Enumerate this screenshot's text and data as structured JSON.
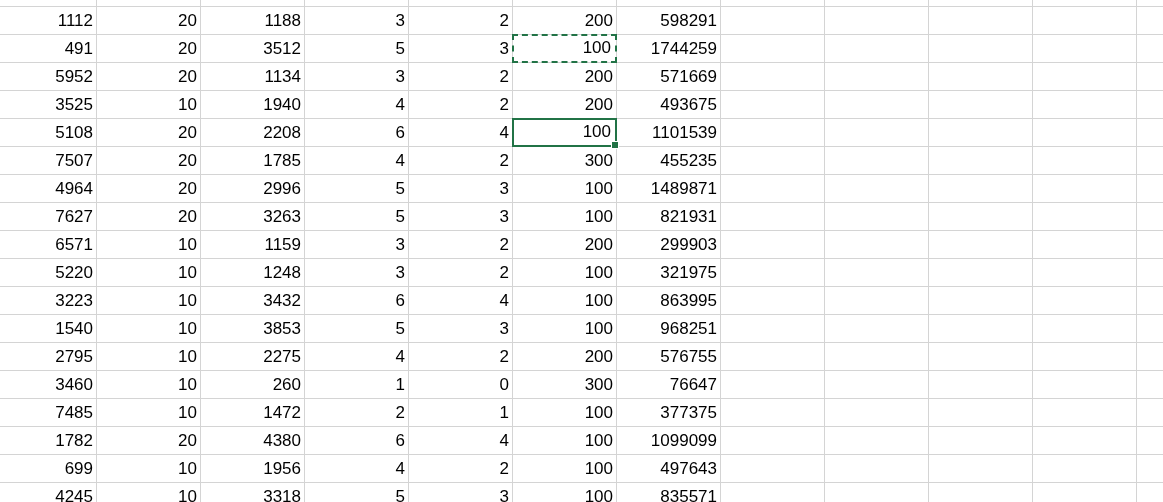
{
  "sheet": {
    "rows": [
      {
        "cells": [
          {
            "text": "1112",
            "selected": false,
            "copied": false
          },
          {
            "text": "20",
            "selected": false,
            "copied": false
          },
          {
            "text": "1188",
            "selected": false,
            "copied": false
          },
          {
            "text": "3",
            "selected": false,
            "copied": false
          },
          {
            "text": "2",
            "selected": false,
            "copied": false
          },
          {
            "text": "200",
            "selected": false,
            "copied": false
          },
          {
            "text": "598291",
            "selected": false,
            "copied": false
          }
        ]
      },
      {
        "cells": [
          {
            "text": "491",
            "selected": false,
            "copied": false
          },
          {
            "text": "20",
            "selected": false,
            "copied": false
          },
          {
            "text": "3512",
            "selected": false,
            "copied": false
          },
          {
            "text": "5",
            "selected": false,
            "copied": false
          },
          {
            "text": "3",
            "selected": false,
            "copied": false
          },
          {
            "text": "100",
            "selected": false,
            "copied": true
          },
          {
            "text": "1744259",
            "selected": false,
            "copied": false
          }
        ]
      },
      {
        "cells": [
          {
            "text": "5952",
            "selected": false,
            "copied": false
          },
          {
            "text": "20",
            "selected": false,
            "copied": false
          },
          {
            "text": "1134",
            "selected": false,
            "copied": false
          },
          {
            "text": "3",
            "selected": false,
            "copied": false
          },
          {
            "text": "2",
            "selected": false,
            "copied": false
          },
          {
            "text": "200",
            "selected": false,
            "copied": false
          },
          {
            "text": "571669",
            "selected": false,
            "copied": false
          }
        ]
      },
      {
        "cells": [
          {
            "text": "3525",
            "selected": false,
            "copied": false
          },
          {
            "text": "10",
            "selected": false,
            "copied": false
          },
          {
            "text": "1940",
            "selected": false,
            "copied": false
          },
          {
            "text": "4",
            "selected": false,
            "copied": false
          },
          {
            "text": "2",
            "selected": false,
            "copied": false
          },
          {
            "text": "200",
            "selected": false,
            "copied": false
          },
          {
            "text": "493675",
            "selected": false,
            "copied": false
          }
        ]
      },
      {
        "cells": [
          {
            "text": "5108",
            "selected": false,
            "copied": false
          },
          {
            "text": "20",
            "selected": false,
            "copied": false
          },
          {
            "text": "2208",
            "selected": false,
            "copied": false
          },
          {
            "text": "6",
            "selected": false,
            "copied": false
          },
          {
            "text": "4",
            "selected": false,
            "copied": false
          },
          {
            "text": "100",
            "selected": true,
            "copied": false
          },
          {
            "text": "1101539",
            "selected": false,
            "copied": false
          }
        ]
      },
      {
        "cells": [
          {
            "text": "7507",
            "selected": false,
            "copied": false
          },
          {
            "text": "20",
            "selected": false,
            "copied": false
          },
          {
            "text": "1785",
            "selected": false,
            "copied": false
          },
          {
            "text": "4",
            "selected": false,
            "copied": false
          },
          {
            "text": "2",
            "selected": false,
            "copied": false
          },
          {
            "text": "300",
            "selected": false,
            "copied": false
          },
          {
            "text": "455235",
            "selected": false,
            "copied": false
          }
        ]
      },
      {
        "cells": [
          {
            "text": "4964",
            "selected": false,
            "copied": false
          },
          {
            "text": "20",
            "selected": false,
            "copied": false
          },
          {
            "text": "2996",
            "selected": false,
            "copied": false
          },
          {
            "text": "5",
            "selected": false,
            "copied": false
          },
          {
            "text": "3",
            "selected": false,
            "copied": false
          },
          {
            "text": "100",
            "selected": false,
            "copied": false
          },
          {
            "text": "1489871",
            "selected": false,
            "copied": false
          }
        ]
      },
      {
        "cells": [
          {
            "text": "7627",
            "selected": false,
            "copied": false
          },
          {
            "text": "20",
            "selected": false,
            "copied": false
          },
          {
            "text": "3263",
            "selected": false,
            "copied": false
          },
          {
            "text": "5",
            "selected": false,
            "copied": false
          },
          {
            "text": "3",
            "selected": false,
            "copied": false
          },
          {
            "text": "100",
            "selected": false,
            "copied": false
          },
          {
            "text": "821931",
            "selected": false,
            "copied": false
          }
        ]
      },
      {
        "cells": [
          {
            "text": "6571",
            "selected": false,
            "copied": false
          },
          {
            "text": "10",
            "selected": false,
            "copied": false
          },
          {
            "text": "1159",
            "selected": false,
            "copied": false
          },
          {
            "text": "3",
            "selected": false,
            "copied": false
          },
          {
            "text": "2",
            "selected": false,
            "copied": false
          },
          {
            "text": "200",
            "selected": false,
            "copied": false
          },
          {
            "text": "299903",
            "selected": false,
            "copied": false
          }
        ]
      },
      {
        "cells": [
          {
            "text": "5220",
            "selected": false,
            "copied": false
          },
          {
            "text": "10",
            "selected": false,
            "copied": false
          },
          {
            "text": "1248",
            "selected": false,
            "copied": false
          },
          {
            "text": "3",
            "selected": false,
            "copied": false
          },
          {
            "text": "2",
            "selected": false,
            "copied": false
          },
          {
            "text": "100",
            "selected": false,
            "copied": false
          },
          {
            "text": "321975",
            "selected": false,
            "copied": false
          }
        ]
      },
      {
        "cells": [
          {
            "text": "3223",
            "selected": false,
            "copied": false
          },
          {
            "text": "10",
            "selected": false,
            "copied": false
          },
          {
            "text": "3432",
            "selected": false,
            "copied": false
          },
          {
            "text": "6",
            "selected": false,
            "copied": false
          },
          {
            "text": "4",
            "selected": false,
            "copied": false
          },
          {
            "text": "100",
            "selected": false,
            "copied": false
          },
          {
            "text": "863995",
            "selected": false,
            "copied": false
          }
        ]
      },
      {
        "cells": [
          {
            "text": "1540",
            "selected": false,
            "copied": false
          },
          {
            "text": "10",
            "selected": false,
            "copied": false
          },
          {
            "text": "3853",
            "selected": false,
            "copied": false
          },
          {
            "text": "5",
            "selected": false,
            "copied": false
          },
          {
            "text": "3",
            "selected": false,
            "copied": false
          },
          {
            "text": "100",
            "selected": false,
            "copied": false
          },
          {
            "text": "968251",
            "selected": false,
            "copied": false
          }
        ]
      },
      {
        "cells": [
          {
            "text": "2795",
            "selected": false,
            "copied": false
          },
          {
            "text": "10",
            "selected": false,
            "copied": false
          },
          {
            "text": "2275",
            "selected": false,
            "copied": false
          },
          {
            "text": "4",
            "selected": false,
            "copied": false
          },
          {
            "text": "2",
            "selected": false,
            "copied": false
          },
          {
            "text": "200",
            "selected": false,
            "copied": false
          },
          {
            "text": "576755",
            "selected": false,
            "copied": false
          }
        ]
      },
      {
        "cells": [
          {
            "text": "3460",
            "selected": false,
            "copied": false
          },
          {
            "text": "10",
            "selected": false,
            "copied": false
          },
          {
            "text": "260",
            "selected": false,
            "copied": false
          },
          {
            "text": "1",
            "selected": false,
            "copied": false
          },
          {
            "text": "0",
            "selected": false,
            "copied": false
          },
          {
            "text": "300",
            "selected": false,
            "copied": false
          },
          {
            "text": "76647",
            "selected": false,
            "copied": false
          }
        ]
      },
      {
        "cells": [
          {
            "text": "7485",
            "selected": false,
            "copied": false
          },
          {
            "text": "10",
            "selected": false,
            "copied": false
          },
          {
            "text": "1472",
            "selected": false,
            "copied": false
          },
          {
            "text": "2",
            "selected": false,
            "copied": false
          },
          {
            "text": "1",
            "selected": false,
            "copied": false
          },
          {
            "text": "100",
            "selected": false,
            "copied": false
          },
          {
            "text": "377375",
            "selected": false,
            "copied": false
          }
        ]
      },
      {
        "cells": [
          {
            "text": "1782",
            "selected": false,
            "copied": false
          },
          {
            "text": "20",
            "selected": false,
            "copied": false
          },
          {
            "text": "4380",
            "selected": false,
            "copied": false
          },
          {
            "text": "6",
            "selected": false,
            "copied": false
          },
          {
            "text": "4",
            "selected": false,
            "copied": false
          },
          {
            "text": "100",
            "selected": false,
            "copied": false
          },
          {
            "text": "1099099",
            "selected": false,
            "copied": false
          }
        ]
      },
      {
        "cells": [
          {
            "text": "699",
            "selected": false,
            "copied": false
          },
          {
            "text": "10",
            "selected": false,
            "copied": false
          },
          {
            "text": "1956",
            "selected": false,
            "copied": false
          },
          {
            "text": "4",
            "selected": false,
            "copied": false
          },
          {
            "text": "2",
            "selected": false,
            "copied": false
          },
          {
            "text": "100",
            "selected": false,
            "copied": false
          },
          {
            "text": "497643",
            "selected": false,
            "copied": false
          }
        ]
      },
      {
        "cells": [
          {
            "text": "4245",
            "selected": false,
            "copied": false
          },
          {
            "text": "10",
            "selected": false,
            "copied": false
          },
          {
            "text": "3318",
            "selected": false,
            "copied": false
          },
          {
            "text": "5",
            "selected": false,
            "copied": false
          },
          {
            "text": "3",
            "selected": false,
            "copied": false
          },
          {
            "text": "100",
            "selected": false,
            "copied": false
          },
          {
            "text": "835571",
            "selected": false,
            "copied": false
          }
        ]
      }
    ]
  }
}
